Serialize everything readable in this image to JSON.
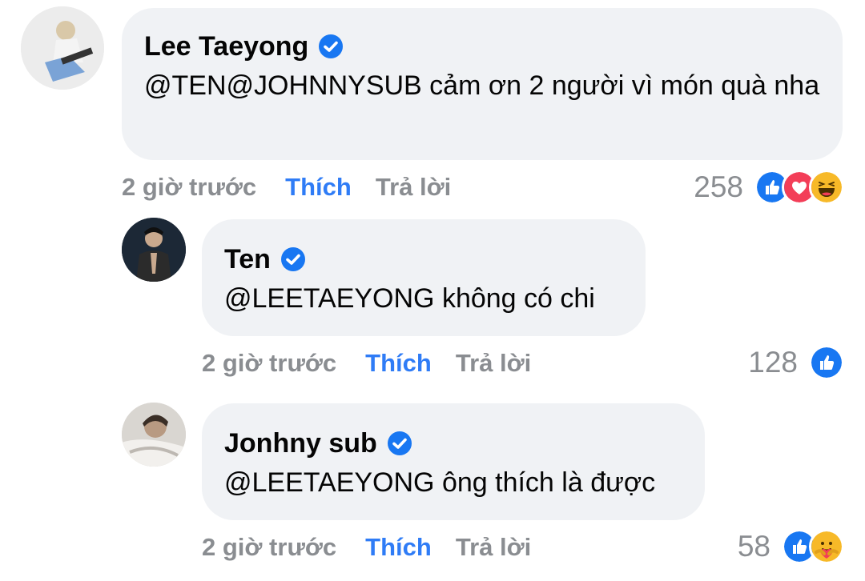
{
  "comments": [
    {
      "author": "Lee Taeyong",
      "text": "@TEN@JOHNNYSUB cảm ơn 2 người vì món quà nha",
      "time": "2 giờ trước",
      "like_label": "Thích",
      "reply_label": "Trả lời",
      "reaction_count": "258",
      "reactions": [
        "like-icon",
        "love-icon",
        "haha-icon"
      ]
    },
    {
      "author": "Ten",
      "text": "@LEETAEYONG không có chi",
      "time": "2 giờ trước",
      "like_label": "Thích",
      "reply_label": "Trả lời",
      "reaction_count": "128",
      "reactions": [
        "like-icon"
      ]
    },
    {
      "author": "Jonhny sub",
      "text": "@LEETAEYONG ông thích là được",
      "time": "2 giờ trước",
      "like_label": "Thích",
      "reply_label": "Trả lời",
      "reaction_count": "58",
      "reactions": [
        "like-icon",
        "care-icon"
      ]
    }
  ],
  "colors": {
    "bubble": "#f0f2f5",
    "like_blue": "#2f7cf6",
    "muted": "#8a8d91",
    "verified": "#1877f2",
    "love_red": "#f33e58",
    "haha_yellow": "#f7b928"
  }
}
